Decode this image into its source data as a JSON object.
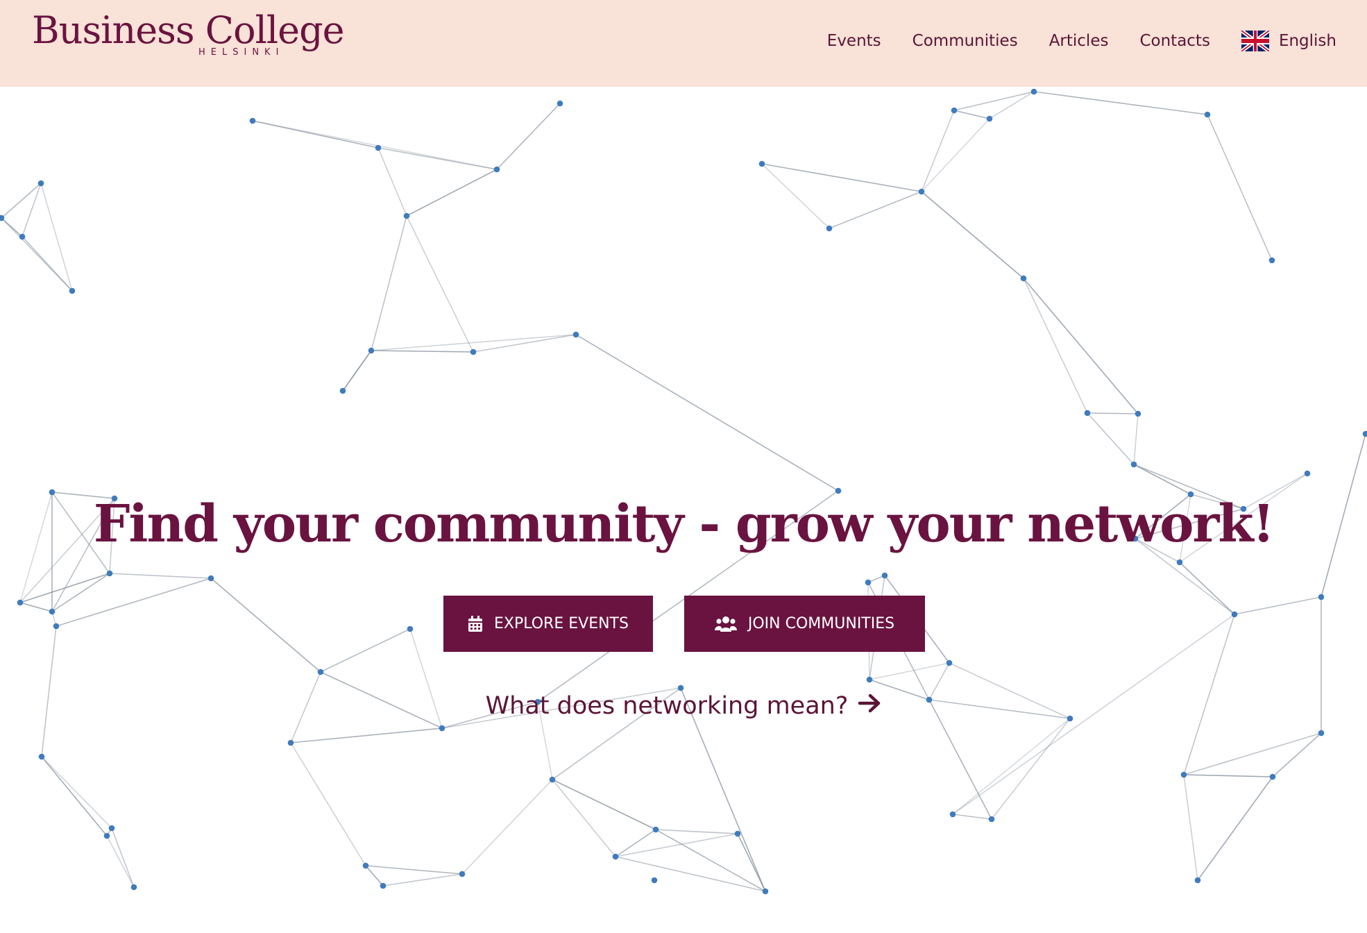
{
  "header": {
    "logo": {
      "title": "Business College",
      "subtitle": "HELSINKI"
    },
    "nav": {
      "events": "Events",
      "communities": "Communities",
      "articles": "Articles",
      "contacts": "Contacts",
      "language": "English",
      "language_icon": "uk-flag-icon"
    }
  },
  "hero": {
    "headline": "Find your community - grow your network!",
    "buttons": {
      "explore_events": "EXPLORE EVENTS",
      "explore_events_icon": "calendar-icon",
      "join_communities": "JOIN COMMUNITIES",
      "join_communities_icon": "users-icon"
    },
    "learn_more": {
      "label": "What does networking mean?",
      "icon": "arrow-right-icon"
    }
  },
  "colors": {
    "brand": "#6a1340",
    "header_bg": "#f9e2d7",
    "node": "#3f7bbd",
    "edge": "#8c96a4"
  }
}
